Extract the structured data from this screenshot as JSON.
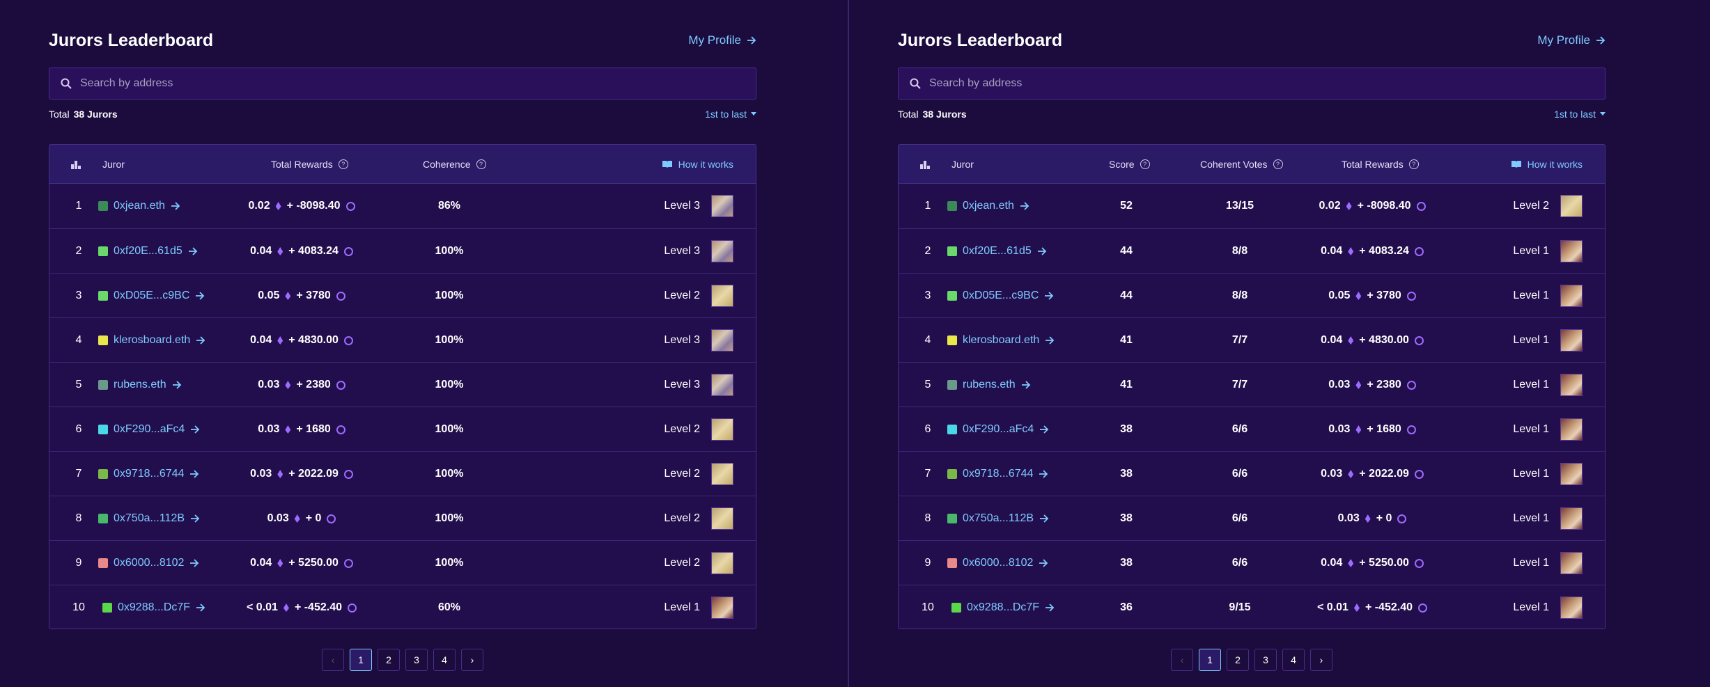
{
  "left": {
    "title": "Jurors Leaderboard",
    "profile_link": "My Profile",
    "search_placeholder": "Search by address",
    "total_label": "Total",
    "total_count": "38 Jurors",
    "sort_label": "1st to last",
    "columns": {
      "juror": "Juror",
      "total_rewards": "Total Rewards",
      "coherence": "Coherence",
      "how_it_works": "How it works"
    },
    "rows": [
      {
        "rank": "1",
        "name": "0xjean.eth",
        "eth": "0.02",
        "pnk": "+ -8098.40",
        "coherence": "86%",
        "level": "Level 3",
        "level_img": "lv3",
        "avatar": "#3a8a5a"
      },
      {
        "rank": "2",
        "name": "0xf20E...61d5",
        "eth": "0.04",
        "pnk": "+ 4083.24",
        "coherence": "100%",
        "level": "Level 3",
        "level_img": "lv3",
        "avatar": "#6ad86a"
      },
      {
        "rank": "3",
        "name": "0xD05E...c9BC",
        "eth": "0.05",
        "pnk": "+ 3780",
        "coherence": "100%",
        "level": "Level 2",
        "level_img": "lv2",
        "avatar": "#6ad86a"
      },
      {
        "rank": "4",
        "name": "klerosboard.eth",
        "eth": "0.04",
        "pnk": "+ 4830.00",
        "coherence": "100%",
        "level": "Level 3",
        "level_img": "lv3",
        "avatar": "#e8e84a"
      },
      {
        "rank": "5",
        "name": "rubens.eth",
        "eth": "0.03",
        "pnk": "+ 2380",
        "coherence": "100%",
        "level": "Level 3",
        "level_img": "lv3",
        "avatar": "#6a9a8a"
      },
      {
        "rank": "6",
        "name": "0xF290...aFc4",
        "eth": "0.03",
        "pnk": "+ 1680",
        "coherence": "100%",
        "level": "Level 2",
        "level_img": "lv2",
        "avatar": "#4ad8e8"
      },
      {
        "rank": "7",
        "name": "0x9718...6744",
        "eth": "0.03",
        "pnk": "+ 2022.09",
        "coherence": "100%",
        "level": "Level 2",
        "level_img": "lv2",
        "avatar": "#7ab84a"
      },
      {
        "rank": "8",
        "name": "0x750a...112B",
        "eth": "0.03",
        "pnk": "+ 0",
        "coherence": "100%",
        "level": "Level 2",
        "level_img": "lv2",
        "avatar": "#4ab86a"
      },
      {
        "rank": "9",
        "name": "0x6000...8102",
        "eth": "0.04",
        "pnk": "+ 5250.00",
        "coherence": "100%",
        "level": "Level 2",
        "level_img": "lv2",
        "avatar": "#e88a8a"
      },
      {
        "rank": "10",
        "name": "0x9288...Dc7F",
        "eth": "< 0.01",
        "pnk": "+ -452.40",
        "coherence": "60%",
        "level": "Level 1",
        "level_img": "lv1",
        "avatar": "#5ad84a"
      }
    ],
    "pages": [
      "1",
      "2",
      "3",
      "4"
    ]
  },
  "right": {
    "title": "Jurors Leaderboard",
    "profile_link": "My Profile",
    "search_placeholder": "Search by address",
    "total_label": "Total",
    "total_count": "38 Jurors",
    "sort_label": "1st to last",
    "columns": {
      "juror": "Juror",
      "score": "Score",
      "coherent_votes": "Coherent Votes",
      "total_rewards": "Total Rewards",
      "how_it_works": "How it works"
    },
    "rows": [
      {
        "rank": "1",
        "name": "0xjean.eth",
        "score": "52",
        "votes": "13/15",
        "eth": "0.02",
        "pnk": "+ -8098.40",
        "level": "Level 2",
        "level_img": "lv2",
        "avatar": "#3a8a5a"
      },
      {
        "rank": "2",
        "name": "0xf20E...61d5",
        "score": "44",
        "votes": "8/8",
        "eth": "0.04",
        "pnk": "+ 4083.24",
        "level": "Level 1",
        "level_img": "lv1",
        "avatar": "#6ad86a"
      },
      {
        "rank": "3",
        "name": "0xD05E...c9BC",
        "score": "44",
        "votes": "8/8",
        "eth": "0.05",
        "pnk": "+ 3780",
        "level": "Level 1",
        "level_img": "lv1",
        "avatar": "#6ad86a"
      },
      {
        "rank": "4",
        "name": "klerosboard.eth",
        "score": "41",
        "votes": "7/7",
        "eth": "0.04",
        "pnk": "+ 4830.00",
        "level": "Level 1",
        "level_img": "lv1",
        "avatar": "#e8e84a"
      },
      {
        "rank": "5",
        "name": "rubens.eth",
        "score": "41",
        "votes": "7/7",
        "eth": "0.03",
        "pnk": "+ 2380",
        "level": "Level 1",
        "level_img": "lv1",
        "avatar": "#6a9a8a"
      },
      {
        "rank": "6",
        "name": "0xF290...aFc4",
        "score": "38",
        "votes": "6/6",
        "eth": "0.03",
        "pnk": "+ 1680",
        "level": "Level 1",
        "level_img": "lv1",
        "avatar": "#4ad8e8"
      },
      {
        "rank": "7",
        "name": "0x9718...6744",
        "score": "38",
        "votes": "6/6",
        "eth": "0.03",
        "pnk": "+ 2022.09",
        "level": "Level 1",
        "level_img": "lv1",
        "avatar": "#7ab84a"
      },
      {
        "rank": "8",
        "name": "0x750a...112B",
        "score": "38",
        "votes": "6/6",
        "eth": "0.03",
        "pnk": "+ 0",
        "level": "Level 1",
        "level_img": "lv1",
        "avatar": "#4ab86a"
      },
      {
        "rank": "9",
        "name": "0x6000...8102",
        "score": "38",
        "votes": "6/6",
        "eth": "0.04",
        "pnk": "+ 5250.00",
        "level": "Level 1",
        "level_img": "lv1",
        "avatar": "#e88a8a"
      },
      {
        "rank": "10",
        "name": "0x9288...Dc7F",
        "score": "36",
        "votes": "9/15",
        "eth": "< 0.01",
        "pnk": "+ -452.40",
        "level": "Level 1",
        "level_img": "lv1",
        "avatar": "#5ad84a"
      }
    ],
    "pages": [
      "1",
      "2",
      "3",
      "4"
    ]
  },
  "colors": {
    "background": "#1c0c3e",
    "link": "#7ecbff",
    "accent": "#9d6bff"
  }
}
